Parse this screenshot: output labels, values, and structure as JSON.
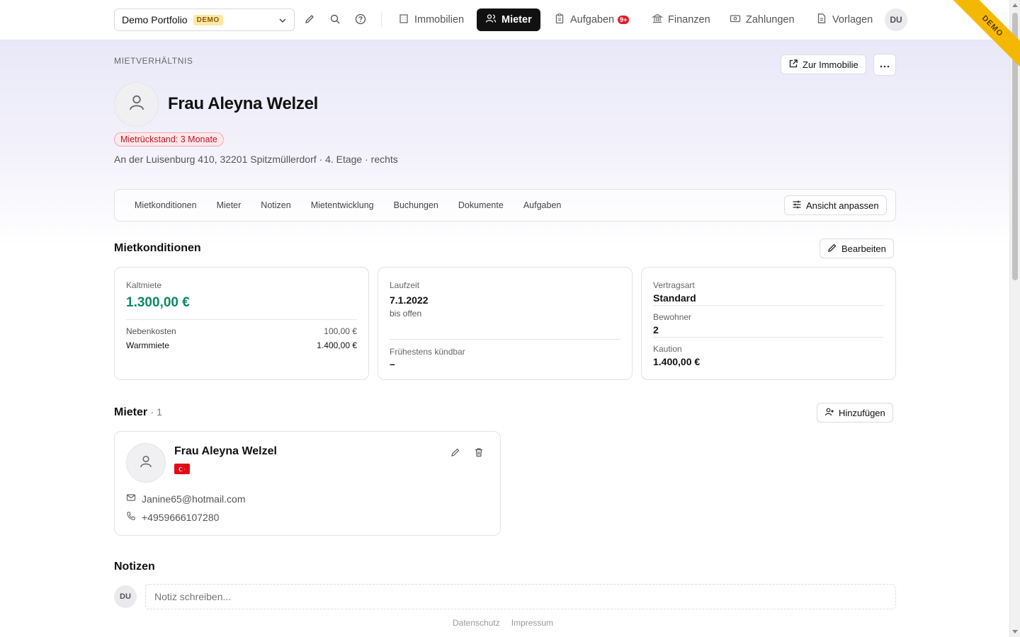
{
  "topbar": {
    "portfolio_name": "Demo Portfolio",
    "portfolio_badge": "DEMO",
    "nav": [
      {
        "label": "Immobilien",
        "icon": "building-icon"
      },
      {
        "label": "Mieter",
        "icon": "users-icon",
        "active": true
      },
      {
        "label": "Aufgaben",
        "icon": "clipboard-icon",
        "badge": "9+"
      },
      {
        "label": "Finanzen",
        "icon": "bank-icon"
      },
      {
        "label": "Zahlungen",
        "icon": "cash-icon"
      },
      {
        "label": "Vorlagen",
        "icon": "document-icon"
      }
    ],
    "user_initials": "DU",
    "ribbon": "DEMO"
  },
  "header": {
    "eyebrow": "MIETVERHÄLTNIS",
    "to_property_label": "Zur Immobilie",
    "name": "Frau Aleyna Welzel",
    "arrears_badge": "Mietrückstand: 3 Monate",
    "address": "An der Luisenburg 410, 32201 Spitzmüllerdorf · 4. Etage · rechts"
  },
  "tabs": [
    "Mietkonditionen",
    "Mieter",
    "Notizen",
    "Mietentwicklung",
    "Buchungen",
    "Dokumente",
    "Aufgaben"
  ],
  "customize_view_label": "Ansicht anpassen",
  "conditions": {
    "title": "Mietkonditionen",
    "edit_label": "Bearbeiten",
    "cold_rent_label": "Kaltmiete",
    "cold_rent_value": "1.300,00 €",
    "ancillary_label": "Nebenkosten",
    "ancillary_value": "100,00 €",
    "warm_rent_label": "Warmmiete",
    "warm_rent_value": "1.400,00 €",
    "term_label": "Laufzeit",
    "term_start": "7.1.2022",
    "term_end": "bis offen",
    "earliest_termination_label": "Frühestens kündbar",
    "earliest_termination_value": "–",
    "contract_type_label": "Vertragsart",
    "contract_type_value": "Standard",
    "residents_label": "Bewohner",
    "residents_value": "2",
    "deposit_label": "Kaution",
    "deposit_value": "1.400,00 €"
  },
  "tenants": {
    "title": "Mieter",
    "count": "· 1",
    "add_label": "Hinzufügen",
    "items": [
      {
        "name": "Frau Aleyna Welzel",
        "email": "Janine65@hotmail.com",
        "phone": "+4959666107280",
        "flag_color": "#e30a17"
      }
    ]
  },
  "notes": {
    "title": "Notizen",
    "avatar": "DU",
    "placeholder": "Notiz schreiben..."
  },
  "footer": {
    "privacy": "Datenschutz",
    "imprint": "Impressum"
  }
}
